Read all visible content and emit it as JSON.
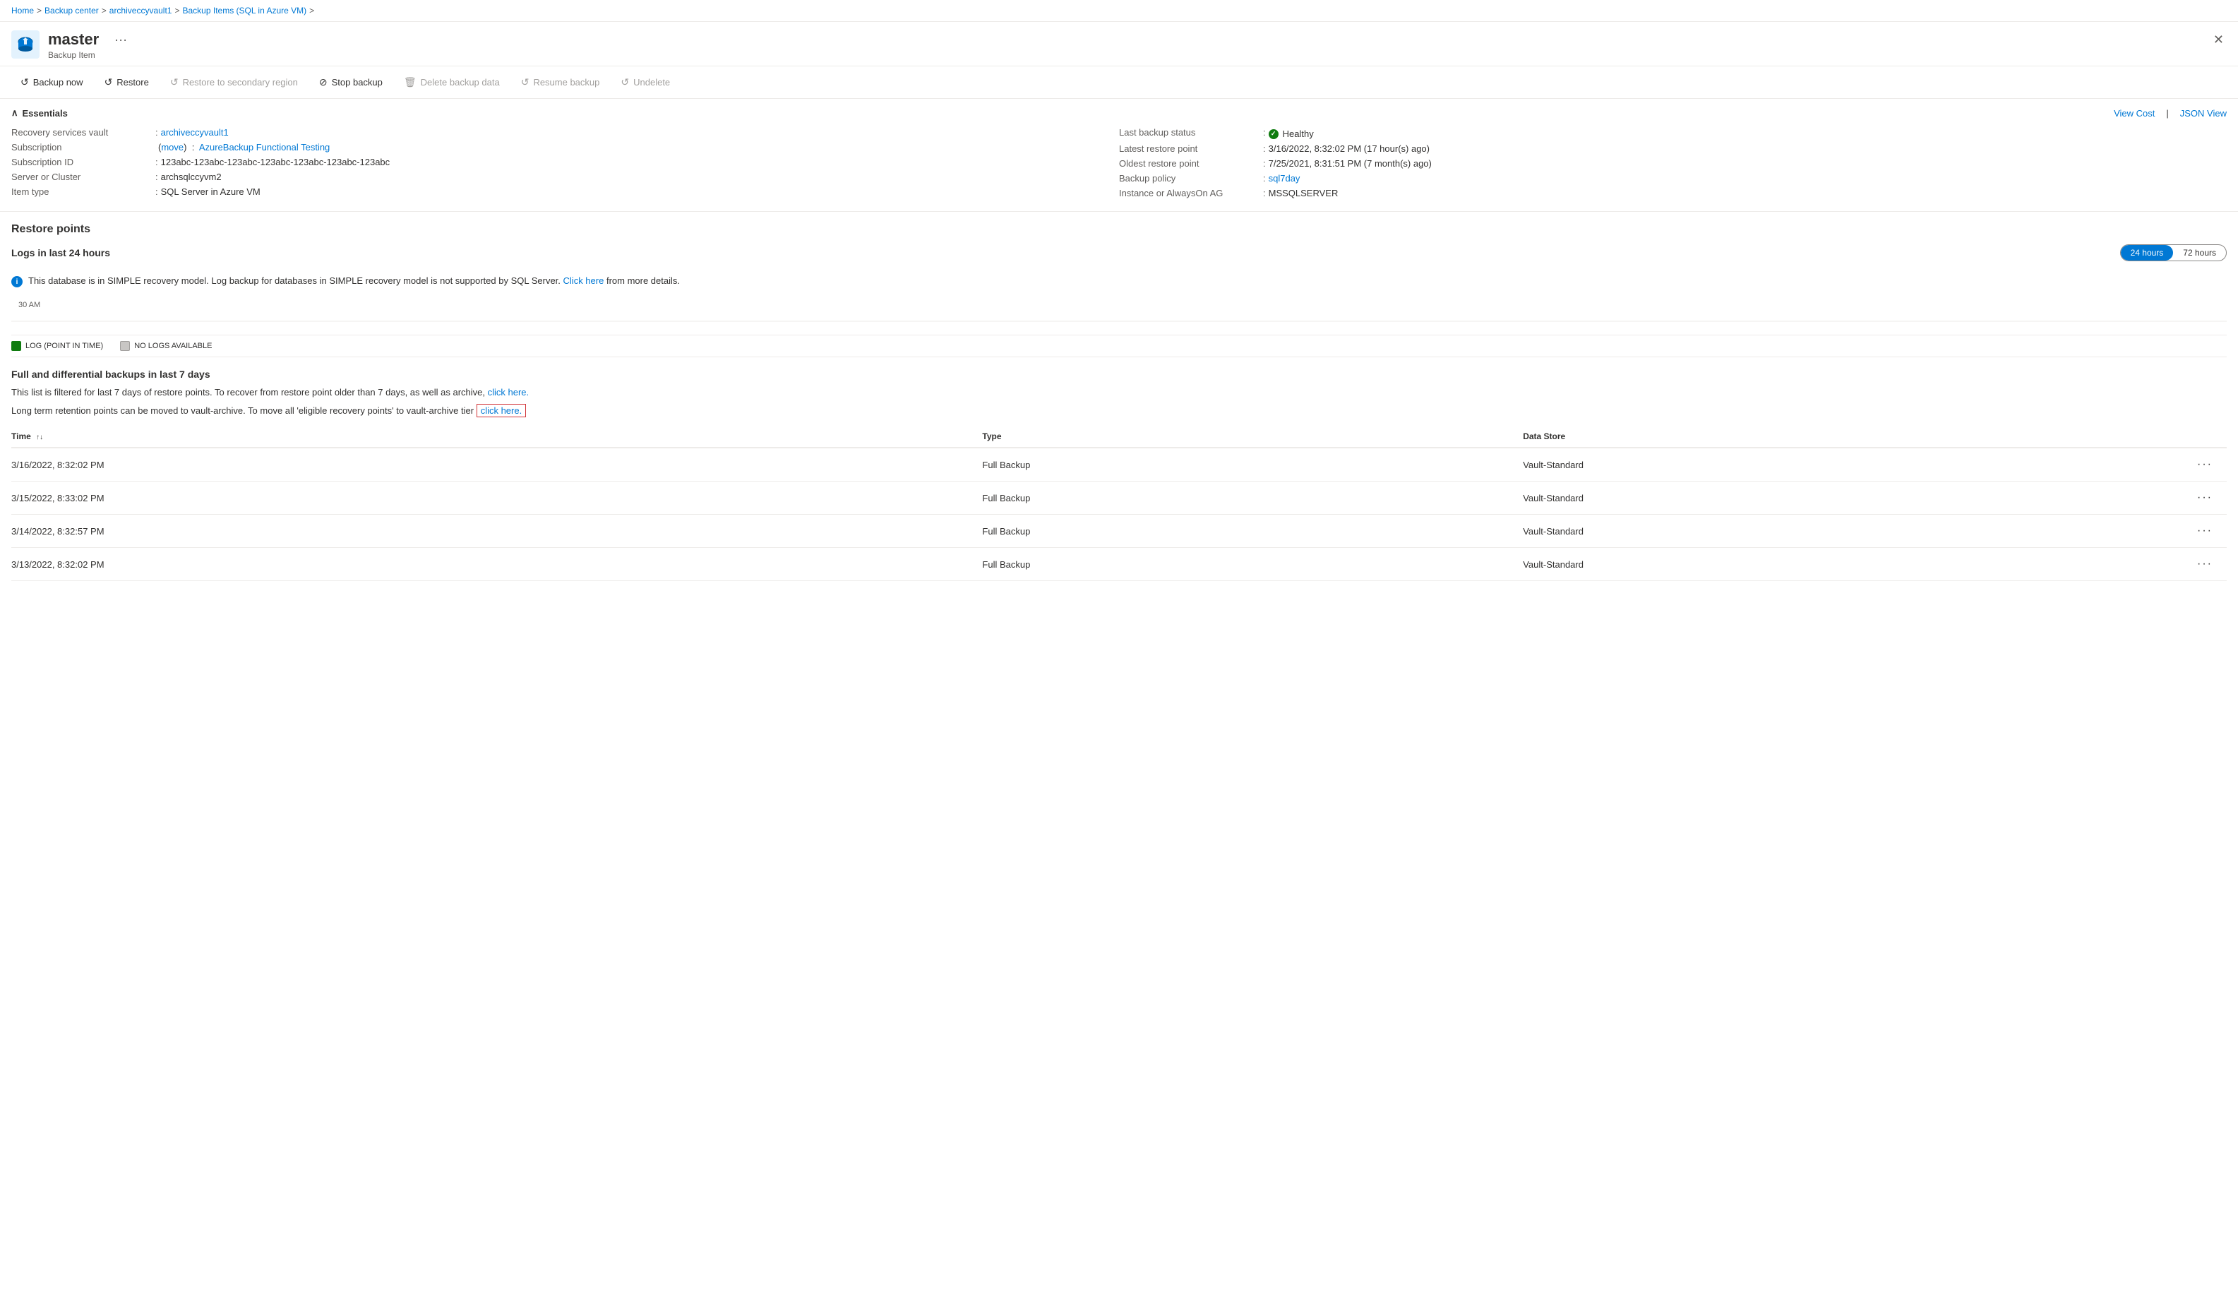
{
  "breadcrumb": {
    "items": [
      {
        "label": "Home",
        "link": true
      },
      {
        "label": "Backup center",
        "link": true
      },
      {
        "label": "archiveccyvault1",
        "link": true
      },
      {
        "label": "Backup Items (SQL in Azure VM)",
        "link": true
      }
    ]
  },
  "header": {
    "title": "master",
    "subtitle": "Backup Item",
    "more_icon": "···"
  },
  "toolbar": {
    "buttons": [
      {
        "label": "Backup now",
        "icon": "↺",
        "disabled": false
      },
      {
        "label": "Restore",
        "icon": "↺",
        "disabled": false
      },
      {
        "label": "Restore to secondary region",
        "icon": "↺",
        "disabled": true
      },
      {
        "label": "Stop backup",
        "icon": "⊘",
        "disabled": false
      },
      {
        "label": "Delete backup data",
        "icon": "🗑",
        "disabled": true
      },
      {
        "label": "Resume backup",
        "icon": "↺",
        "disabled": true
      },
      {
        "label": "Undelete",
        "icon": "↺",
        "disabled": true
      }
    ]
  },
  "essentials": {
    "section_title": "Essentials",
    "view_cost": "View Cost",
    "json_view": "JSON View",
    "left_fields": [
      {
        "label": "Recovery services vault",
        "value": "archiveccyvault1",
        "link": true
      },
      {
        "label": "Subscription",
        "value_parts": [
          {
            "text": "(move)",
            "link": true
          },
          {
            "text": " : "
          },
          {
            "text": "AzureBackup Functional Testing",
            "link": true
          }
        ],
        "complex": true
      },
      {
        "label": "Subscription ID",
        "value": "123abc-123abc-123abc-123abc-123abc-123abc-123abc"
      },
      {
        "label": "Server or Cluster",
        "value": "archsqlccyvm2"
      },
      {
        "label": "Item type",
        "value": "SQL Server in Azure VM"
      }
    ],
    "right_fields": [
      {
        "label": "Last backup status",
        "value": "Healthy",
        "status": true
      },
      {
        "label": "Latest restore point",
        "value": "3/16/2022, 8:32:02 PM (17 hour(s) ago)"
      },
      {
        "label": "Oldest restore point",
        "value": "7/25/2021, 8:31:51 PM (7 month(s) ago)"
      },
      {
        "label": "Backup policy",
        "value": "sql7day",
        "link": true
      },
      {
        "label": "Instance or AlwaysOn AG",
        "value": "MSSQLSERVER"
      }
    ]
  },
  "restore_points": {
    "section_title": "Restore points"
  },
  "logs_section": {
    "title": "Logs in last 24 hours",
    "time_options": [
      "24 hours",
      "72 hours"
    ],
    "active_time": "24 hours",
    "info_text": "This database is in SIMPLE recovery model. Log backup for databases in SIMPLE recovery model is not supported by SQL Server.",
    "click_here_text": "Click here",
    "info_suffix": " from more details.",
    "timeline_label": "30 AM",
    "legend": [
      {
        "label": "LOG (POINT IN TIME)",
        "color": "#107c10"
      },
      {
        "label": "NO LOGS AVAILABLE",
        "color": "#e0e0e0"
      }
    ]
  },
  "full_backups": {
    "title": "Full and differential backups in last 7 days",
    "desc1": "This list is filtered for last 7 days of restore points. To recover from restore point older than 7 days, as well as archive,",
    "click_here1": "click here.",
    "desc2": "Long term retention points can be moved to vault-archive. To move all 'eligible recovery points' to vault-archive tier",
    "click_here2": "click here.",
    "table": {
      "columns": [
        {
          "label": "Time",
          "sortable": true
        },
        {
          "label": "Type",
          "sortable": false
        },
        {
          "label": "Data Store",
          "sortable": false
        },
        {
          "label": "",
          "sortable": false
        }
      ],
      "rows": [
        {
          "time": "3/16/2022, 8:32:02 PM",
          "type": "Full Backup",
          "data_store": "Vault-Standard"
        },
        {
          "time": "3/15/2022, 8:33:02 PM",
          "type": "Full Backup",
          "data_store": "Vault-Standard"
        },
        {
          "time": "3/14/2022, 8:32:57 PM",
          "type": "Full Backup",
          "data_store": "Vault-Standard"
        },
        {
          "time": "3/13/2022, 8:32:02 PM",
          "type": "Full Backup",
          "data_store": "Vault-Standard"
        }
      ]
    }
  }
}
